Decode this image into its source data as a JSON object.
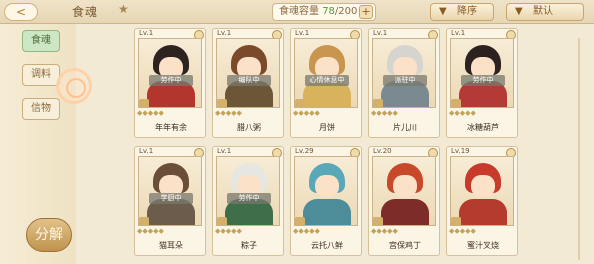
{
  "header": {
    "back": "<",
    "title": "食魂",
    "star": "★",
    "capacity_label": "食魂容量",
    "capacity_current": "78",
    "capacity_total": "/200",
    "plus": "+",
    "sort_label": "降序",
    "filter_label": "默认",
    "caret": "▼"
  },
  "sidebar": {
    "tabs": [
      {
        "label": "食魂",
        "active": true
      },
      {
        "label": "调料",
        "active": false
      },
      {
        "label": "信物",
        "active": false
      }
    ],
    "decompose_label": "分解"
  },
  "cards": [
    {
      "level": "Lv.1",
      "status": "劳作中",
      "name": "年年有余",
      "hair": "#2d2420",
      "body": "#b2352e"
    },
    {
      "level": "Lv.1",
      "status": "编队中",
      "name": "腊八粥",
      "hair": "#7b4a2a",
      "body": "#6d5538"
    },
    {
      "level": "Lv.1",
      "status": "心情休息中",
      "name": "月饼",
      "hair": "#c99650",
      "body": "#d9b35c"
    },
    {
      "level": "Lv.1",
      "status": "派驻中",
      "name": "片儿川",
      "hair": "#d6d4cf",
      "body": "#7a8a90"
    },
    {
      "level": "Lv.1",
      "status": "劳作中",
      "name": "冰糖葫芦",
      "hair": "#2c2220",
      "body": "#b43a35"
    },
    {
      "level": "Lv.1",
      "status": "学厨中",
      "name": "猫耳朵",
      "hair": "#6b4e38",
      "body": "#6b5c4c"
    },
    {
      "level": "Lv.1",
      "status": "劳作中",
      "name": "粽子",
      "hair": "#e6e6e2",
      "body": "#3f6e4a"
    },
    {
      "level": "Lv.29",
      "status": "",
      "name": "云托八鲜",
      "hair": "#5aa7b8",
      "body": "#4d8d9a"
    },
    {
      "level": "Lv.20",
      "status": "",
      "name": "宫保鸡丁",
      "hair": "#c8482c",
      "body": "#7d2c2a"
    },
    {
      "level": "Lv.19",
      "status": "",
      "name": "蜜汁叉烧",
      "hair": "#c83a2c",
      "body": "#b53b2f"
    }
  ]
}
